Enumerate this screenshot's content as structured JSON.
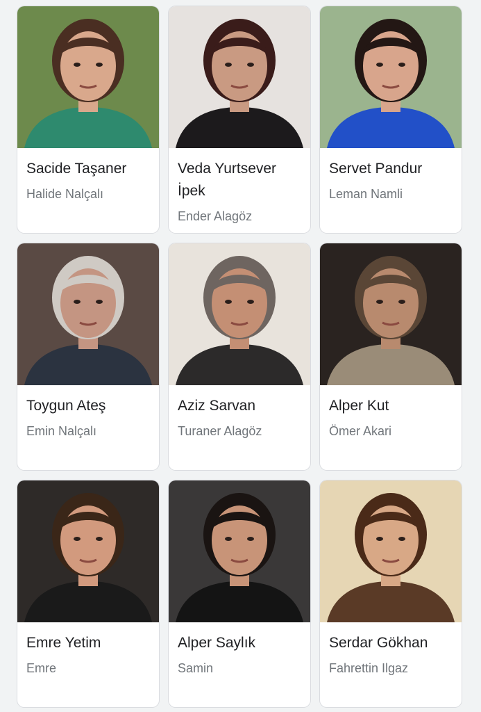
{
  "cast": [
    {
      "name": "Sacide Taşaner",
      "role": "Halide Nalçalı",
      "bg": "#6d8a4c",
      "shirt": "#2e8a6e",
      "hair": "#4a2e22",
      "skin": "#d9a88c"
    },
    {
      "name": "Veda Yurtsever İpek",
      "role": "Ender Alagöz",
      "bg": "#e6e2df",
      "shirt": "#1c1a1c",
      "hair": "#3a1c1a",
      "skin": "#c99a82"
    },
    {
      "name": "Servet Pandur",
      "role": "Leman Namli",
      "bg": "#9bb48e",
      "shirt": "#2250c8",
      "hair": "#231714",
      "skin": "#d8a58c"
    },
    {
      "name": "Toygun Ateş",
      "role": "Emin Nalçalı",
      "bg": "#5a4a44",
      "shirt": "#2b3340",
      "hair": "#cfcac4",
      "skin": "#c49582"
    },
    {
      "name": "Aziz Sarvan",
      "role": "Turaner Alagöz",
      "bg": "#e8e3dc",
      "shirt": "#2c2a2a",
      "hair": "#6e6560",
      "skin": "#c48f74"
    },
    {
      "name": "Alper Kut",
      "role": "Ömer Akari",
      "bg": "#2a2320",
      "shirt": "#9a8c78",
      "hair": "#5a4636",
      "skin": "#b88a6e"
    },
    {
      "name": "Emre Yetim",
      "role": "Emre",
      "bg": "#2e2a28",
      "shirt": "#1a1a1a",
      "hair": "#3a2618",
      "skin": "#d29a7e"
    },
    {
      "name": "Alper Saylık",
      "role": "Samin",
      "bg": "#3a3838",
      "shirt": "#141414",
      "hair": "#1a1412",
      "skin": "#c89478"
    },
    {
      "name": "Serdar Gökhan",
      "role": "Fahrettin Ilgaz",
      "bg": "#e6d6b4",
      "shirt": "#5a3a26",
      "hair": "#4a2a18",
      "skin": "#d8a886"
    }
  ]
}
